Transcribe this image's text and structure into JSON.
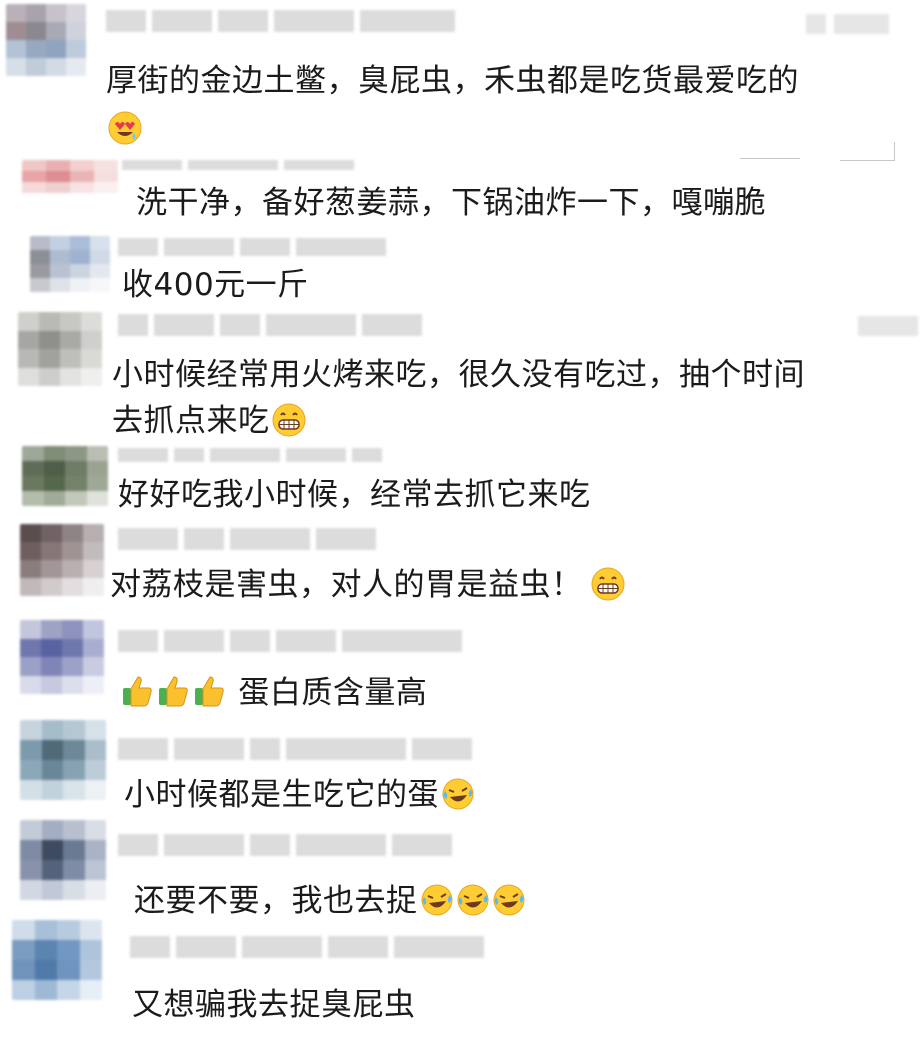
{
  "comments": [
    {
      "text": "厚街的金边土鳖，臭屁虫，禾虫都是吃货最爱吃的",
      "emoji": "heart-eyes-face"
    },
    {
      "text": "洗干净，备好葱姜蒜，下锅油炸一下，嘎嘣脆"
    },
    {
      "text": "收400元一斤"
    },
    {
      "text_line1": "小时候经常用火烤来吃，很久没有吃过，抽个时间",
      "text_line2": "去抓点来吃",
      "emoji": "grinning-face"
    },
    {
      "text": "好好吃我小时候，经常去抓它来吃"
    },
    {
      "text": "对荔枝是害虫，对人的胃是益虫！",
      "emoji": "grinning-face"
    },
    {
      "prefix_emoji": "thumbs-up x3",
      "text": "蛋白质含量高"
    },
    {
      "text": "小时候都是生吃它的蛋",
      "emoji": "crying-laughing-face"
    },
    {
      "text": "还要不要，我也去捉",
      "emoji": "crying-laughing-face x3"
    },
    {
      "text": "又想骗我去捉臭屁虫"
    }
  ]
}
